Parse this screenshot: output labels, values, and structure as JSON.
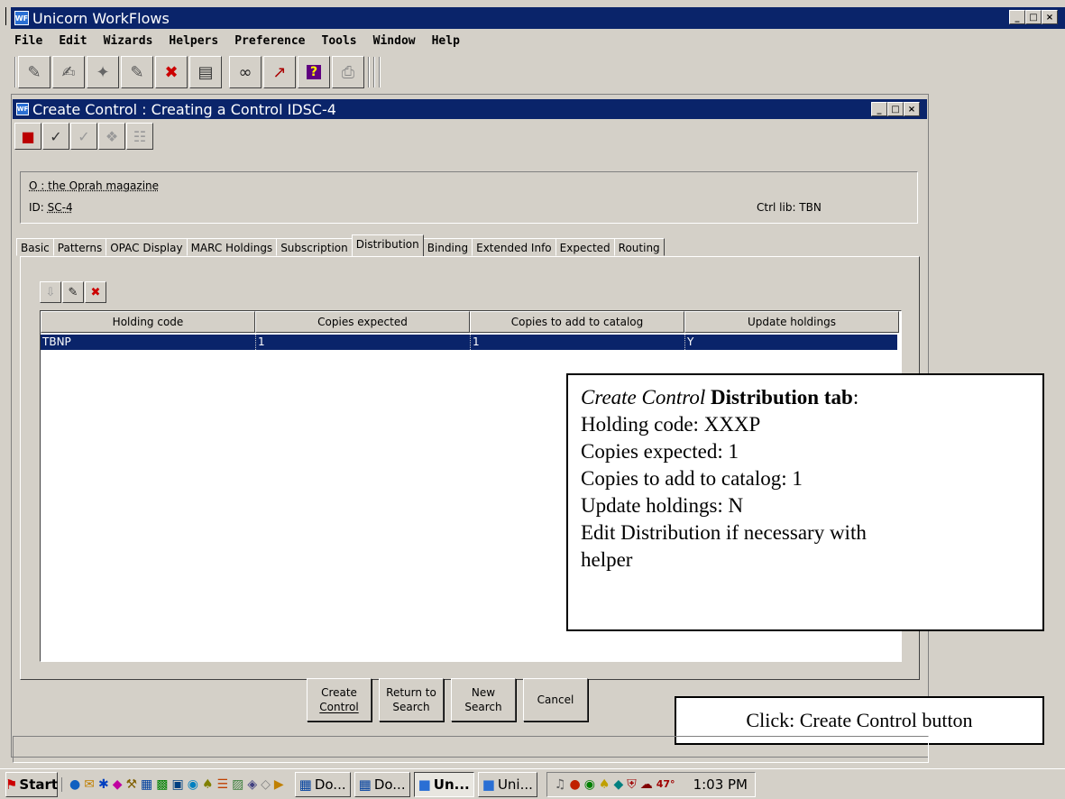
{
  "app": {
    "title": "Unicorn WorkFlows",
    "window_buttons": [
      "_",
      "□",
      "×"
    ]
  },
  "menu": [
    "File",
    "Edit",
    "Wizards",
    "Helpers",
    "Preference",
    "Tools",
    "Window",
    "Help"
  ],
  "toolbar": {
    "icons": [
      "checkout-icon",
      "discharge-icon",
      "items-icon",
      "users-icon",
      "delete-icon",
      "display-icon",
      "glasses-icon",
      "report-icon",
      "help-icon",
      "print-icon"
    ]
  },
  "child": {
    "title": "Create Control : Creating a Control IDSC-4",
    "window_buttons": [
      "_",
      "□",
      "×"
    ],
    "toolbar_icons": [
      "book-icon",
      "edit-icon",
      "check-icon",
      "copy-icon",
      "stack-icon"
    ]
  },
  "info": {
    "title": "O : the Oprah magazine",
    "id_label": "ID:",
    "id_value": "SC-4",
    "ctrl_lib": "Ctrl lib: TBN"
  },
  "tabs": [
    "Basic",
    "Patterns",
    "OPAC Display",
    "MARC Holdings",
    "Subscription",
    "Distribution",
    "Binding",
    "Extended Info",
    "Expected",
    "Routing"
  ],
  "active_tab": "Distribution",
  "grid": {
    "tool_icons": [
      "add-row-icon",
      "edit-row-icon",
      "delete-row-icon"
    ],
    "columns": [
      "Holding code",
      "Copies expected",
      "Copies to add to catalog",
      "Update holdings"
    ],
    "rows": [
      [
        "TBNP",
        "1",
        "1",
        "Y"
      ]
    ]
  },
  "callout_distribution": {
    "title_italic": "Create Control",
    "title_bold": "Distribution tab",
    "title_colon": ":",
    "lines": [
      "Holding code: XXXP",
      "Copies expected: 1",
      "Copies to add to catalog: 1",
      "Update holdings: N",
      "Edit Distribution if necessary with",
      "helper"
    ]
  },
  "buttons": {
    "create_control_l1": "Create",
    "create_control_l2": "Control",
    "return_l1": "Return to",
    "return_l2": "Search",
    "new_l1": "New",
    "new_l2": "Search",
    "cancel": "Cancel"
  },
  "callout_click": "Click: Create Control button",
  "taskbar": {
    "start": "Start",
    "tasks": [
      "Do...",
      "Do...",
      "Un...",
      "Uni..."
    ],
    "temp": "47°",
    "time": "1:03 PM"
  }
}
